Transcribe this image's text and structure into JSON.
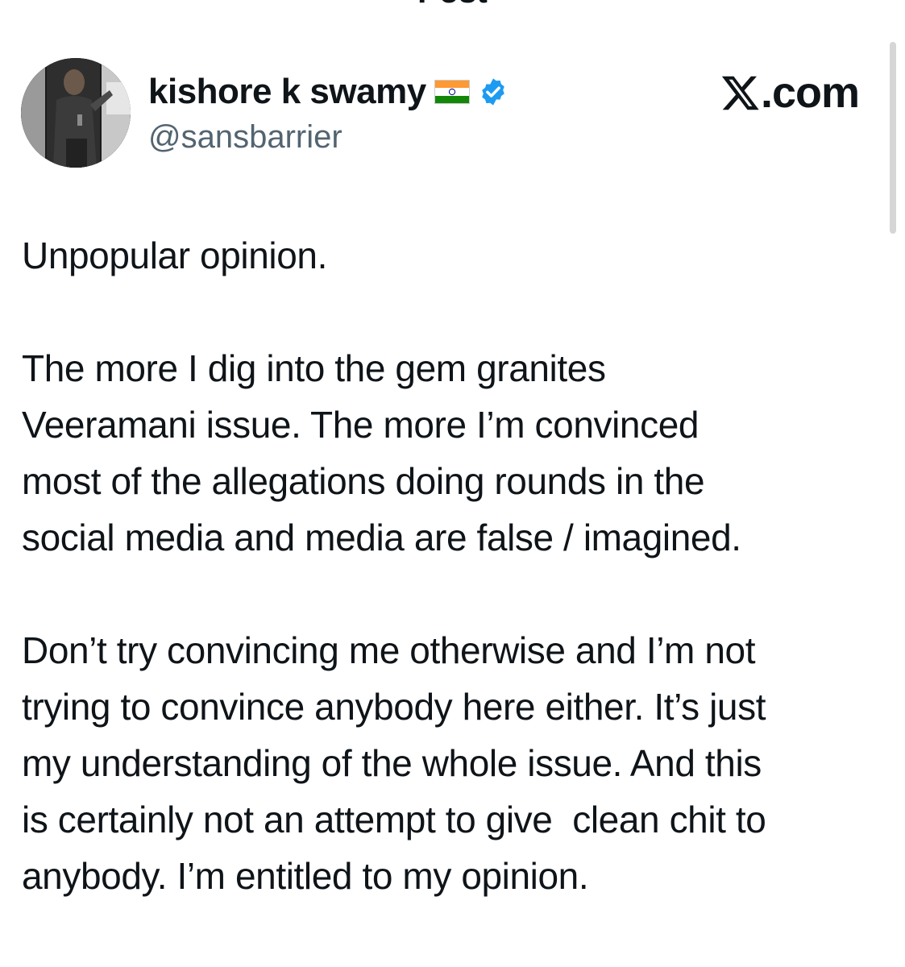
{
  "top_bar": {
    "title": "Post",
    "back_icon": "arrow-left-icon"
  },
  "post": {
    "author": {
      "display_name": "kishore k swamy",
      "handle": "@sansbarrier",
      "flag_icon": "india-flag-icon",
      "verified_icon": "verified-badge-icon",
      "verified_color": "#1d9bf0"
    },
    "site_label": "com",
    "site_logo_icon": "x-logo-icon",
    "paragraphs": [
      "Unpopular opinion.",
      "The more I dig into the gem granites\nVeeramani issue. The more I’m convinced\nmost of the allegations doing rounds in the\nsocial media and media are false / imagined.",
      "Don’t try convincing me otherwise and I’m not\ntrying to convince anybody here either. It’s just\nmy understanding of the whole issue. And this\nis certainly not an attempt to give  clean chit to\nanybody. I’m entitled to my opinion."
    ]
  },
  "colors": {
    "text": "#0f1419",
    "secondary_text": "#536471",
    "accent": "#1d9bf0",
    "background": "#ffffff"
  }
}
